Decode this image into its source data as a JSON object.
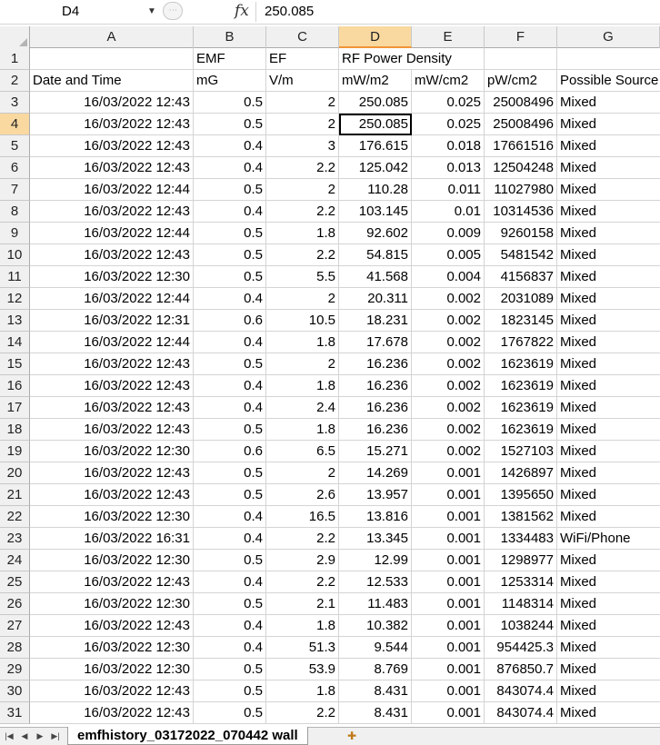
{
  "formula_bar": {
    "name_box": "D4",
    "fx_icon": "fx",
    "value": "250.085"
  },
  "columns": [
    "A",
    "B",
    "C",
    "D",
    "E",
    "F",
    "G"
  ],
  "rows": [
    {
      "num": "1",
      "cells": [
        "",
        "EMF",
        "EF",
        "RF Power Density",
        "",
        "",
        ""
      ]
    },
    {
      "num": "2",
      "cells": [
        "Date and Time",
        "mG",
        "V/m",
        "mW/m2",
        "mW/cm2",
        "pW/cm2",
        "Possible Source"
      ]
    },
    {
      "num": "3",
      "cells": [
        "16/03/2022 12:43",
        "0.5",
        "2",
        "250.085",
        "0.025",
        "25008496",
        "Mixed"
      ]
    },
    {
      "num": "4",
      "cells": [
        "16/03/2022 12:43",
        "0.5",
        "2",
        "250.085",
        "0.025",
        "25008496",
        "Mixed"
      ]
    },
    {
      "num": "5",
      "cells": [
        "16/03/2022 12:43",
        "0.4",
        "3",
        "176.615",
        "0.018",
        "17661516",
        "Mixed"
      ]
    },
    {
      "num": "6",
      "cells": [
        "16/03/2022 12:43",
        "0.4",
        "2.2",
        "125.042",
        "0.013",
        "12504248",
        "Mixed"
      ]
    },
    {
      "num": "7",
      "cells": [
        "16/03/2022 12:44",
        "0.5",
        "2",
        "110.28",
        "0.011",
        "11027980",
        "Mixed"
      ]
    },
    {
      "num": "8",
      "cells": [
        "16/03/2022 12:43",
        "0.4",
        "2.2",
        "103.145",
        "0.01",
        "10314536",
        "Mixed"
      ]
    },
    {
      "num": "9",
      "cells": [
        "16/03/2022 12:44",
        "0.5",
        "1.8",
        "92.602",
        "0.009",
        "9260158",
        "Mixed"
      ]
    },
    {
      "num": "10",
      "cells": [
        "16/03/2022 12:43",
        "0.5",
        "2.2",
        "54.815",
        "0.005",
        "5481542",
        "Mixed"
      ]
    },
    {
      "num": "11",
      "cells": [
        "16/03/2022 12:30",
        "0.5",
        "5.5",
        "41.568",
        "0.004",
        "4156837",
        "Mixed"
      ]
    },
    {
      "num": "12",
      "cells": [
        "16/03/2022 12:44",
        "0.4",
        "2",
        "20.311",
        "0.002",
        "2031089",
        "Mixed"
      ]
    },
    {
      "num": "13",
      "cells": [
        "16/03/2022 12:31",
        "0.6",
        "10.5",
        "18.231",
        "0.002",
        "1823145",
        "Mixed"
      ]
    },
    {
      "num": "14",
      "cells": [
        "16/03/2022 12:44",
        "0.4",
        "1.8",
        "17.678",
        "0.002",
        "1767822",
        "Mixed"
      ]
    },
    {
      "num": "15",
      "cells": [
        "16/03/2022 12:43",
        "0.5",
        "2",
        "16.236",
        "0.002",
        "1623619",
        "Mixed"
      ]
    },
    {
      "num": "16",
      "cells": [
        "16/03/2022 12:43",
        "0.4",
        "1.8",
        "16.236",
        "0.002",
        "1623619",
        "Mixed"
      ]
    },
    {
      "num": "17",
      "cells": [
        "16/03/2022 12:43",
        "0.4",
        "2.4",
        "16.236",
        "0.002",
        "1623619",
        "Mixed"
      ]
    },
    {
      "num": "18",
      "cells": [
        "16/03/2022 12:43",
        "0.5",
        "1.8",
        "16.236",
        "0.002",
        "1623619",
        "Mixed"
      ]
    },
    {
      "num": "19",
      "cells": [
        "16/03/2022 12:30",
        "0.6",
        "6.5",
        "15.271",
        "0.002",
        "1527103",
        "Mixed"
      ]
    },
    {
      "num": "20",
      "cells": [
        "16/03/2022 12:43",
        "0.5",
        "2",
        "14.269",
        "0.001",
        "1426897",
        "Mixed"
      ]
    },
    {
      "num": "21",
      "cells": [
        "16/03/2022 12:43",
        "0.5",
        "2.6",
        "13.957",
        "0.001",
        "1395650",
        "Mixed"
      ]
    },
    {
      "num": "22",
      "cells": [
        "16/03/2022 12:30",
        "0.4",
        "16.5",
        "13.816",
        "0.001",
        "1381562",
        "Mixed"
      ]
    },
    {
      "num": "23",
      "cells": [
        "16/03/2022 16:31",
        "0.4",
        "2.2",
        "13.345",
        "0.001",
        "1334483",
        "WiFi/Phone"
      ]
    },
    {
      "num": "24",
      "cells": [
        "16/03/2022 12:30",
        "0.5",
        "2.9",
        "12.99",
        "0.001",
        "1298977",
        "Mixed"
      ]
    },
    {
      "num": "25",
      "cells": [
        "16/03/2022 12:43",
        "0.4",
        "2.2",
        "12.533",
        "0.001",
        "1253314",
        "Mixed"
      ]
    },
    {
      "num": "26",
      "cells": [
        "16/03/2022 12:30",
        "0.5",
        "2.1",
        "11.483",
        "0.001",
        "1148314",
        "Mixed"
      ]
    },
    {
      "num": "27",
      "cells": [
        "16/03/2022 12:43",
        "0.4",
        "1.8",
        "10.382",
        "0.001",
        "1038244",
        "Mixed"
      ]
    },
    {
      "num": "28",
      "cells": [
        "16/03/2022 12:30",
        "0.4",
        "51.3",
        "9.544",
        "0.001",
        "954425.3",
        "Mixed"
      ]
    },
    {
      "num": "29",
      "cells": [
        "16/03/2022 12:30",
        "0.5",
        "53.9",
        "8.769",
        "0.001",
        "876850.7",
        "Mixed"
      ]
    },
    {
      "num": "30",
      "cells": [
        "16/03/2022 12:43",
        "0.5",
        "1.8",
        "8.431",
        "0.001",
        "843074.4",
        "Mixed"
      ]
    },
    {
      "num": "31",
      "cells": [
        "16/03/2022 12:43",
        "0.5",
        "2.2",
        "8.431",
        "0.001",
        "843074.4",
        "Mixed"
      ]
    }
  ],
  "selected": {
    "row": "4",
    "col": "D"
  },
  "sheet_tab": "emfhistory_03172022_070442 wall",
  "colors": {
    "selected_header": "#f9d99f",
    "header_bg": "#f0f0f0",
    "gridline": "#d4d4d4"
  }
}
